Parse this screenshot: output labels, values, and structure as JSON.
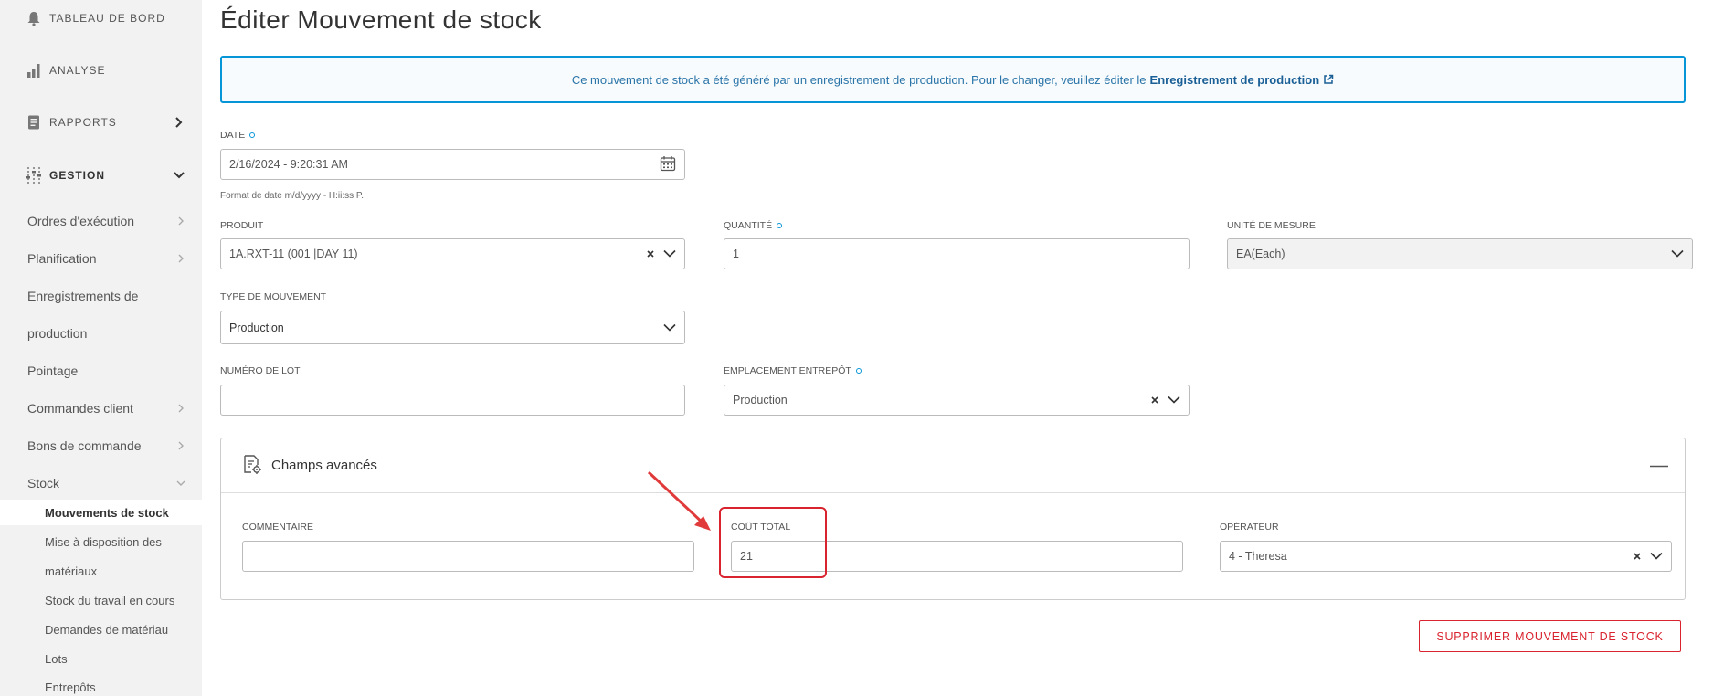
{
  "sidebar": {
    "top_items": [
      {
        "label": "TABLEAU DE BORD",
        "icon": "bell-icon"
      },
      {
        "label": "ANALYSE",
        "icon": "bar-chart-icon"
      },
      {
        "label": "RAPPORTS",
        "icon": "report-icon"
      },
      {
        "label": "GESTION",
        "icon": "sliders-icon"
      }
    ],
    "gestion_items": [
      {
        "label": "Ordres d'exécution"
      },
      {
        "label": "Planification"
      },
      {
        "label": "Enregistrements de"
      },
      {
        "label": "production"
      },
      {
        "label": "Pointage"
      },
      {
        "label": "Commandes client"
      },
      {
        "label": "Bons de commande"
      },
      {
        "label": "Stock"
      }
    ],
    "stock_items": [
      {
        "label": "Mouvements de stock"
      },
      {
        "label": "Mise à disposition des"
      },
      {
        "label": "matériaux"
      },
      {
        "label": "Stock du travail en cours"
      },
      {
        "label": "Demandes de matériau"
      },
      {
        "label": "Lots"
      },
      {
        "label": "Entrepôts"
      }
    ]
  },
  "page": {
    "title": "Éditer Mouvement de stock",
    "info_text": "Ce mouvement de stock a été généré par un enregistrement de production. Pour le changer, veuillez éditer le",
    "info_link": "Enregistrement de production"
  },
  "form": {
    "date_label": "DATE",
    "date_value": "2/16/2024 - 9:20:31 AM",
    "date_hint": "Format de date m/d/yyyy - H:ii:ss P.",
    "product_label": "PRODUIT",
    "product_value": "1A.RXT-11 (001 |DAY 11)",
    "quantity_label": "QUANTITÉ",
    "quantity_value": "1",
    "unit_label": "UNITÉ DE MESURE",
    "unit_value": "EA(Each)",
    "movement_type_label": "TYPE DE MOUVEMENT",
    "movement_type_value": "Production",
    "lot_label": "NUMÉRO DE LOT",
    "lot_value": "",
    "warehouse_label": "EMPLACEMENT ENTREPÔT",
    "warehouse_value": "Production"
  },
  "advanced": {
    "title": "Champs avancés",
    "comment_label": "COMMENTAIRE",
    "comment_value": "",
    "total_cost_label": "COÛT TOTAL",
    "total_cost_value": "21",
    "operator_label": "OPÉRATEUR",
    "operator_value": "4 - Theresa"
  },
  "actions": {
    "delete_label": "SUPPRIMER MOUVEMENT DE STOCK"
  },
  "colors": {
    "accent": "#0696d7",
    "danger": "#d9232e",
    "sidebar_bg": "#f2f2f2"
  }
}
